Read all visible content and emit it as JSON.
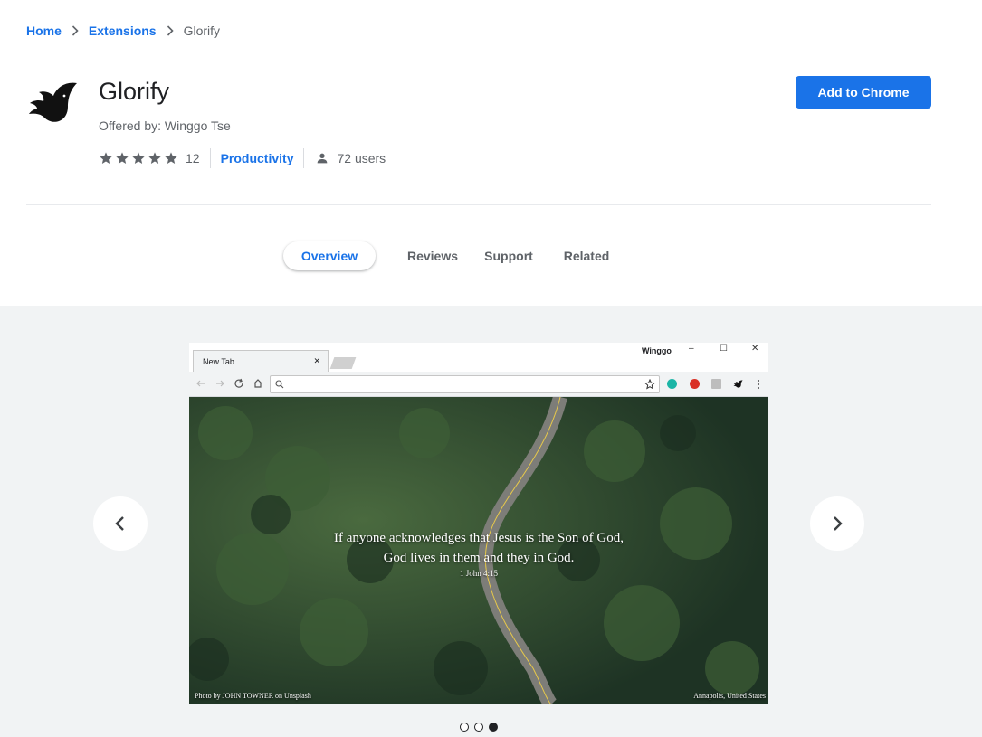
{
  "breadcrumb": {
    "home": "Home",
    "extensions": "Extensions",
    "current": "Glorify"
  },
  "extension": {
    "name": "Glorify",
    "offered_by": "Offered by: Winggo Tse",
    "rating": 5,
    "rating_count": "12",
    "category": "Productivity",
    "users": "72 users",
    "add_button": "Add to Chrome"
  },
  "tabs": [
    {
      "label": "Overview",
      "active": true
    },
    {
      "label": "Reviews",
      "active": false
    },
    {
      "label": "Support",
      "active": false
    },
    {
      "label": "Related",
      "active": false
    }
  ],
  "screenshot": {
    "browser_tab": "New Tab",
    "browser_user": "Winggo",
    "verse": "If anyone acknowledges that Jesus is the Son of God, God lives in them and they in God.",
    "verse_ref": "1 John 4:15",
    "photo_credit": "Photo by JOHN TOWNER on Unsplash",
    "photo_location": "Annapolis, United States"
  },
  "carousel": {
    "count": 3,
    "active_index": 2
  },
  "colors": {
    "accent": "#1a73e8",
    "gallery_bg": "#f1f3f4",
    "muted_text": "#5f6368"
  }
}
